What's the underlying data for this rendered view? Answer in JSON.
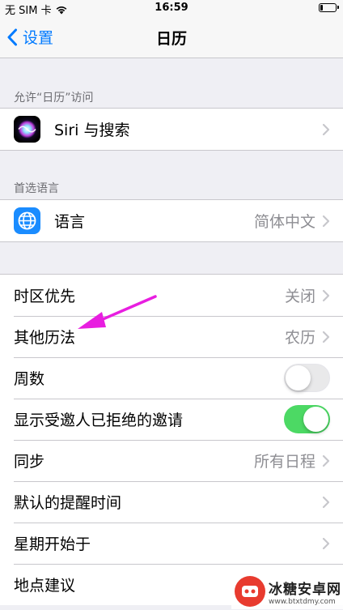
{
  "status_bar": {
    "carrier": "无 SIM 卡",
    "time": "16:59",
    "battery_level": 0.15
  },
  "nav": {
    "back_label": "设置",
    "title": "日历"
  },
  "sections": {
    "access_header": "允许“日历”访问",
    "siri_label": "Siri 与搜索",
    "language_header": "首选语言",
    "language_label": "语言",
    "language_value": "简体中文"
  },
  "settings": {
    "timezone_label": "时区优先",
    "timezone_value": "关闭",
    "alt_calendar_label": "其他历法",
    "alt_calendar_value": "农历",
    "week_numbers_label": "周数",
    "week_numbers_on": false,
    "declined_label": "显示受邀人已拒绝的邀请",
    "declined_on": true,
    "sync_label": "同步",
    "sync_value": "所有日程",
    "alert_label": "默认的提醒时间",
    "week_start_label": "星期开始于",
    "location_label": "地点建议"
  },
  "colors": {
    "accent": "#007aff",
    "switch_on": "#4cd964",
    "annotation": "#e81ee0"
  },
  "watermark": {
    "title": "冰糖安卓网",
    "url": "www.btxtdmy.com"
  }
}
